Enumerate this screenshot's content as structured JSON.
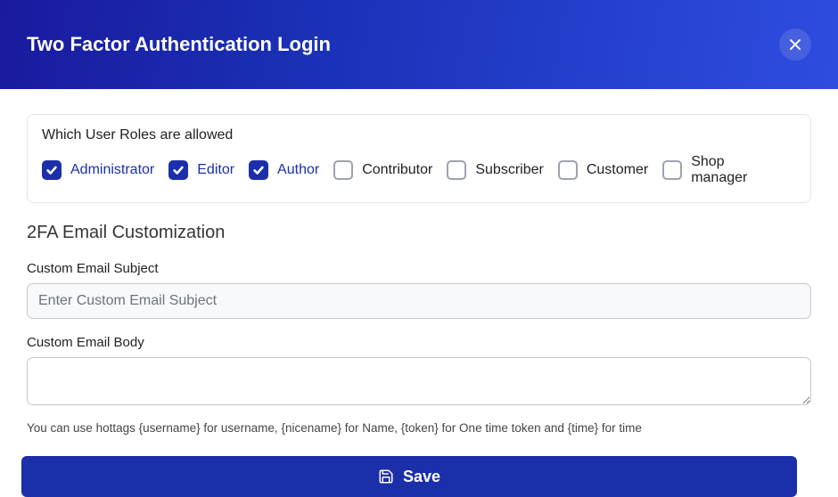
{
  "header": {
    "title": "Two Factor Authentication Login"
  },
  "roles_card": {
    "title": "Which User Roles are allowed",
    "roles": [
      {
        "label": "Administrator",
        "checked": true
      },
      {
        "label": "Editor",
        "checked": true
      },
      {
        "label": "Author",
        "checked": true
      },
      {
        "label": "Contributor",
        "checked": false
      },
      {
        "label": "Subscriber",
        "checked": false
      },
      {
        "label": "Customer",
        "checked": false
      },
      {
        "label": "Shop manager",
        "checked": false
      }
    ]
  },
  "customization": {
    "title": "2FA Email Customization",
    "subject_label": "Custom Email Subject",
    "subject_placeholder": "Enter Custom Email Subject",
    "subject_value": "",
    "body_label": "Custom Email Body",
    "body_value": "",
    "hint": "You can use hottags {username} for username, {nicename} for Name, {token} for One time token and {time} for time"
  },
  "actions": {
    "save_label": "Save"
  }
}
